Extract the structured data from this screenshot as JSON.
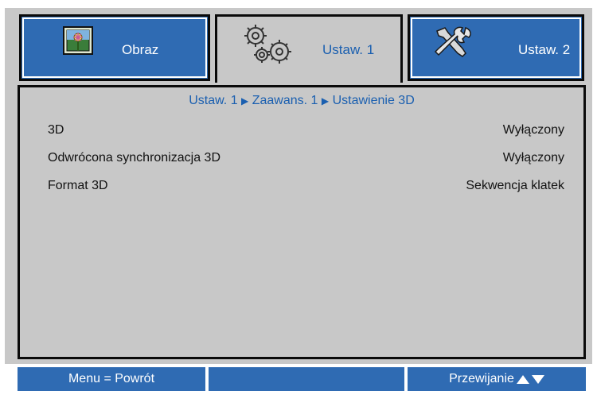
{
  "tabs": {
    "obraz": {
      "label": "Obraz",
      "icon": "image-icon"
    },
    "ustaw1": {
      "label": "Ustaw. 1",
      "icon": "gears-icon"
    },
    "ustaw2": {
      "label": "Ustaw. 2",
      "icon": "tools-icon"
    }
  },
  "breadcrumb": {
    "part1": "Ustaw. 1",
    "part2": "Zaawans. 1",
    "part3": "Ustawienie 3D"
  },
  "settings": [
    {
      "label": "3D",
      "value": "Wyłączony"
    },
    {
      "label": "Odwrócona synchronizacja 3D",
      "value": "Wyłączony"
    },
    {
      "label": "Format 3D",
      "value": "Sekwencja klatek"
    }
  ],
  "footer": {
    "left": "Menu = Powrót",
    "middle": "",
    "right": "Przewijanie"
  },
  "colors": {
    "tab_blue": "#2f6bb3",
    "accent_text": "#1a5fb0",
    "panel_bg": "#c8c8c8"
  }
}
